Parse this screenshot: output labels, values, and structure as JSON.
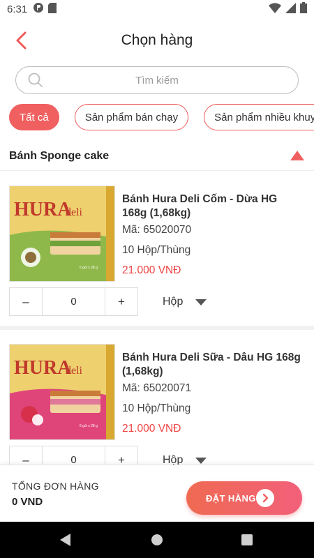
{
  "status_bar": {
    "time": "6:31",
    "icons": [
      "circle-p-icon",
      "sd-card-icon",
      "wifi-icon",
      "signal-icon",
      "battery-icon"
    ]
  },
  "header": {
    "title": "Chọn hàng",
    "back_icon": "chevron-left-icon"
  },
  "search": {
    "placeholder": "Tìm kiếm",
    "value": ""
  },
  "filters": [
    {
      "label": "Tất cả",
      "active": true
    },
    {
      "label": "Sản phẩm bán chạy",
      "active": false
    },
    {
      "label": "Sản phẩm nhiều khuyến mãi",
      "active": false
    }
  ],
  "section": {
    "title": "Bánh Sponge cake",
    "expanded": true
  },
  "products": [
    {
      "name": "Bánh Hura Deli Cốm - Dừa HG 168g (1,68kg)",
      "code": "Mã: 65020070",
      "pack": "10 Hộp/Thùng",
      "price": "21.000 VNĐ",
      "quantity": "0",
      "unit": "Hộp",
      "image": {
        "brand": "HURA",
        "sub": "deli",
        "pack_label": "6 gói x 28 g",
        "accent": "#8fb84a"
      }
    },
    {
      "name": "Bánh Hura Deli Sữa - Dâu HG 168g (1,68kg)",
      "code": "Mã: 65020071",
      "pack": "10 Hộp/Thùng",
      "price": "21.000 VNĐ",
      "quantity": "0",
      "unit": "Hộp",
      "image": {
        "brand": "HURA",
        "sub": "deli",
        "pack_label": "6 gói x 28 g",
        "accent": "#e0457a"
      }
    }
  ],
  "stepper": {
    "minus": "–",
    "plus": "+"
  },
  "footer": {
    "total_label": "TỔNG ĐƠN HÀNG",
    "total_value": "0 VND",
    "order_button": "ĐẶT HÀNG"
  },
  "colors": {
    "accent": "#f06060",
    "price": "#ef4444"
  }
}
